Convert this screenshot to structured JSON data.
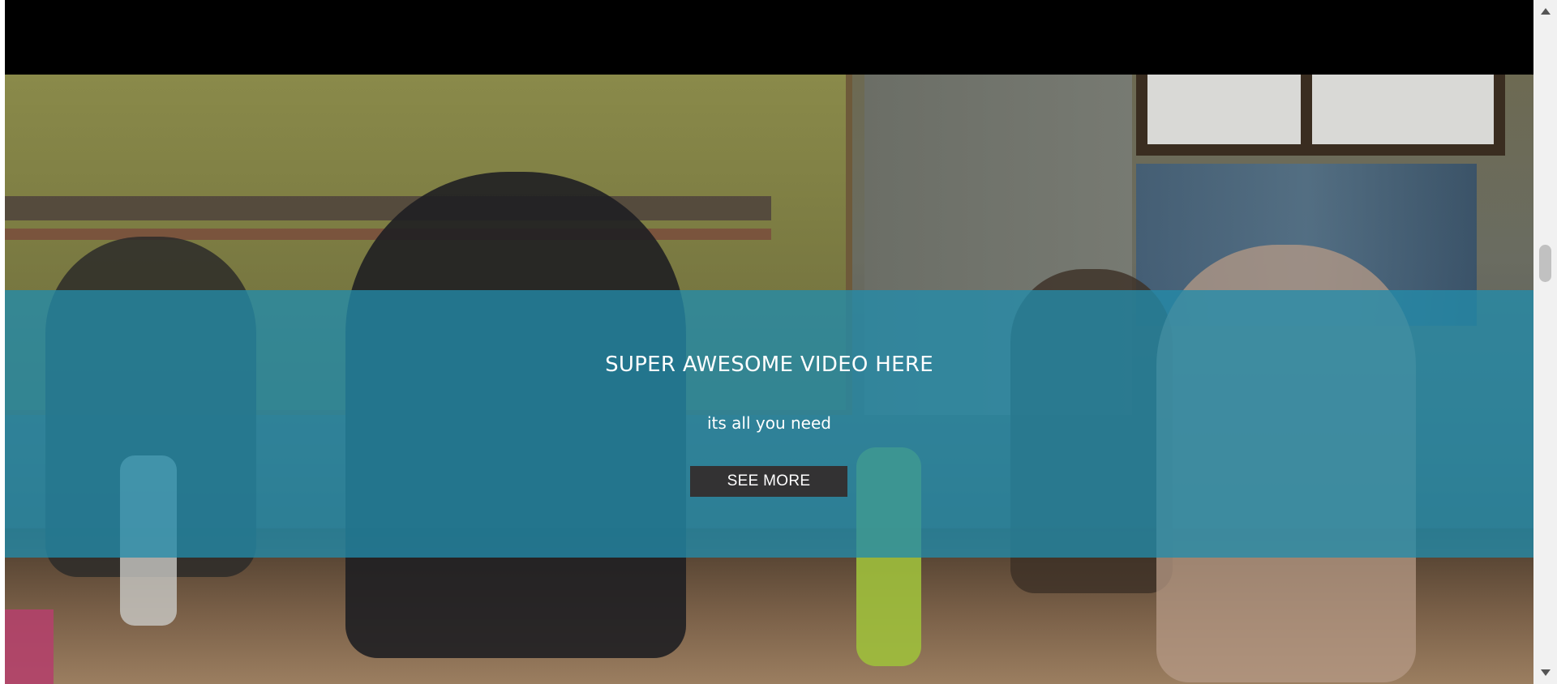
{
  "hero": {
    "title": "SUPER AWESOME VIDEO HERE",
    "subtitle": "its all you need",
    "button_label": "SEE MORE"
  },
  "colors": {
    "overlay": "#238caa",
    "button_bg": "#333233",
    "text": "#ffffff",
    "top_bar": "#000000"
  },
  "icons": {
    "scroll_up": "triangle-up-icon",
    "scroll_down": "triangle-down-icon"
  }
}
